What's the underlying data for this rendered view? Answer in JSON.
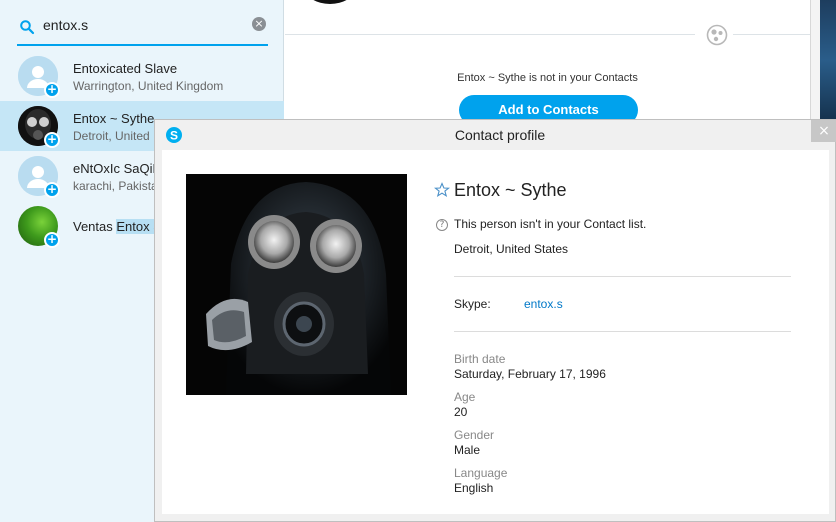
{
  "search": {
    "value": "entox.s"
  },
  "results": [
    {
      "name": "Entoxicated Slave",
      "location": "Warrington, United Kingdom"
    },
    {
      "name": "Entox ~ Sythe",
      "location": "Detroit, United"
    },
    {
      "name": "eNtOxIc SaQiE",
      "location": "karachi, Pakista"
    },
    {
      "name_prefix": "Ventas ",
      "name_highlight": "Entox S",
      "location": ""
    }
  ],
  "conversation": {
    "not_in_contacts": "Entox ~ Sythe is not in your Contacts",
    "add_button": "Add to Contacts"
  },
  "dialog": {
    "title": "Contact profile",
    "close": "×",
    "name": "Entox ~ Sythe",
    "notice": "This person isn't in your Contact list.",
    "location": "Detroit, United States",
    "skype_label": "Skype:",
    "skype_value": "entox.s",
    "fields": [
      {
        "label": "Birth date",
        "value": "Saturday, February 17, 1996"
      },
      {
        "label": "Age",
        "value": "20"
      },
      {
        "label": "Gender",
        "value": "Male"
      },
      {
        "label": "Language",
        "value": "English"
      }
    ]
  },
  "colors": {
    "accent": "#00a2ed",
    "selected_row": "#c5e6f6",
    "sidebar_bg": "#eaf5fb",
    "link": "#0078c8"
  },
  "icons": [
    "search-icon",
    "clear-icon",
    "add-contact-badge-icon",
    "globe-icon",
    "skype-logo-icon",
    "star-icon",
    "question-icon",
    "close-icon"
  ]
}
